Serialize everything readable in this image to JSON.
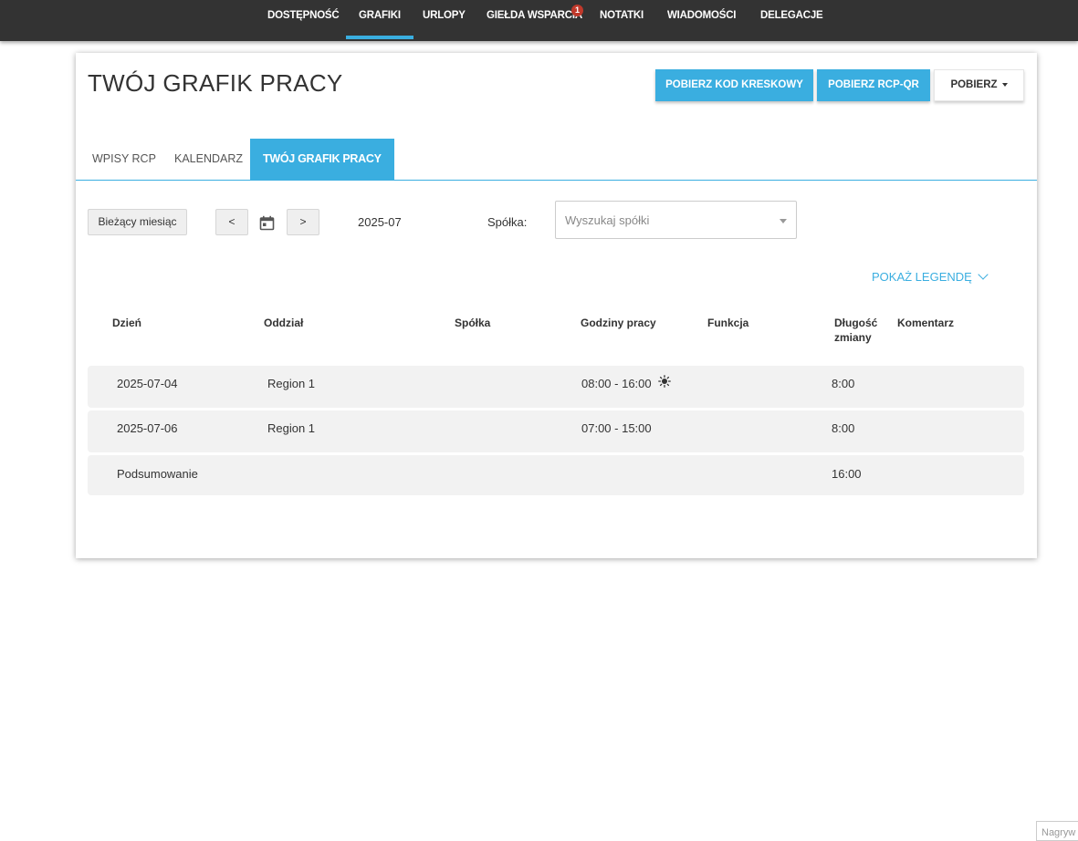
{
  "nav": {
    "items": [
      {
        "label": "DOSTĘPNOŚĆ"
      },
      {
        "label": "GRAFIKI",
        "active": true
      },
      {
        "label": "URLOPY"
      },
      {
        "label": "GIEŁDA WSPARCIA",
        "badge": "1"
      },
      {
        "label": "NOTATKI"
      },
      {
        "label": "WIADOMOŚCI"
      },
      {
        "label": "DELEGACJE"
      }
    ]
  },
  "header": {
    "title": "TWÓJ GRAFIK PRACY",
    "buttons": {
      "barcode": "POBIERZ KOD KRESKOWY",
      "rcp_qr": "POBIERZ RCP-QR",
      "download": "POBIERZ"
    }
  },
  "tabs": [
    {
      "label": "WPISY RCP"
    },
    {
      "label": "KALENDARZ"
    },
    {
      "label": "TWÓJ GRAFIK PRACY",
      "active": true
    }
  ],
  "controls": {
    "current_month": "Bieżący miesiąc",
    "prev": "<",
    "next": ">",
    "month": "2025-07",
    "company_label": "Spółka:",
    "company_placeholder": "Wyszukaj spółki"
  },
  "legend_link": "POKAŻ LEGENDĘ",
  "table": {
    "headers": {
      "day": "Dzień",
      "branch": "Oddział",
      "company": "Spółka",
      "hours": "Godziny pracy",
      "function": "Funkcja",
      "length_1": "Długość",
      "length_2": "zmiany",
      "comment": "Komentarz"
    },
    "rows": [
      {
        "day": "2025-07-04",
        "branch": "Region 1",
        "company": "",
        "hours": "08:00 - 16:00",
        "icon": "sun-icon",
        "function": "",
        "length": "8:00",
        "comment": ""
      },
      {
        "day": "2025-07-06",
        "branch": "Region 1",
        "company": "",
        "hours": "07:00 - 15:00",
        "function": "",
        "length": "8:00",
        "comment": ""
      }
    ],
    "summary": {
      "label": "Podsumowanie",
      "total": "16:00"
    }
  },
  "corner_input_placeholder": "Nagryw"
}
